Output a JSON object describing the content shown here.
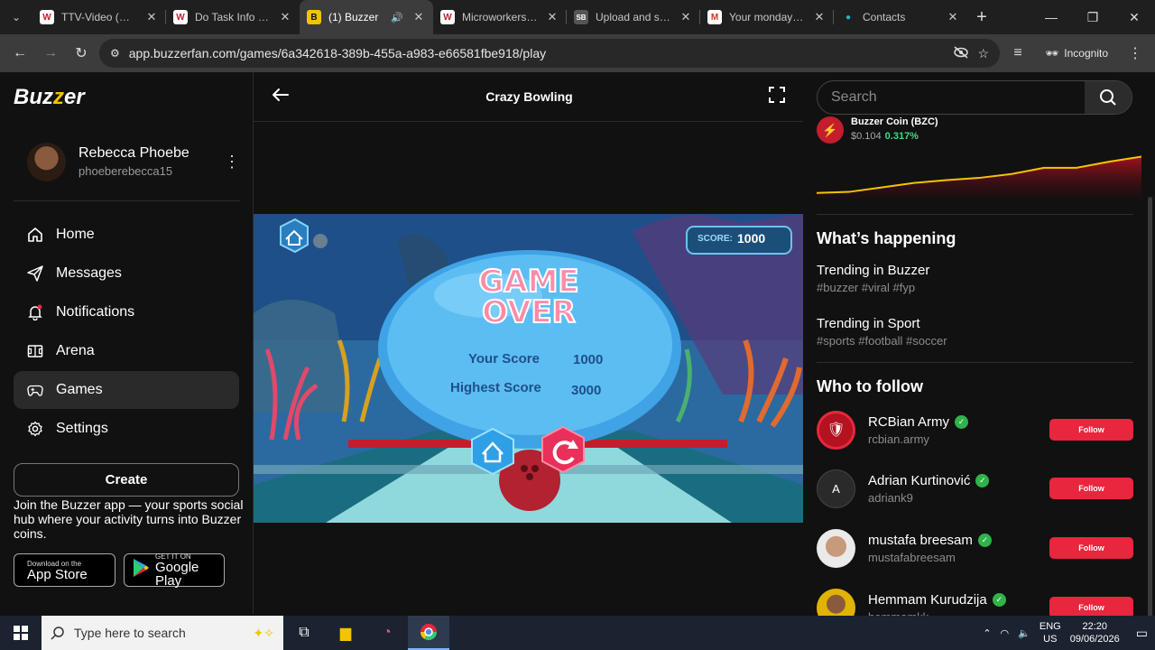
{
  "browser": {
    "tabs": [
      {
        "title": "TTV-Video (CC):",
        "favicon": "W",
        "fav_color": "#c41d2d"
      },
      {
        "title": "Do Task Info | M",
        "favicon": "W",
        "fav_color": "#c41d2d"
      },
      {
        "title": "(1) Buzzer",
        "favicon": "B",
        "fav_color": "#f5c400"
      },
      {
        "title": "Microworkers - v",
        "favicon": "W",
        "fav_color": "#c41d2d"
      },
      {
        "title": "Upload and sha",
        "favicon": "SB",
        "fav_color": "#555555"
      },
      {
        "title": "Your monday CR",
        "favicon": "M",
        "fav_color": "#d93025"
      },
      {
        "title": "Contacts",
        "favicon": "●",
        "fav_color": "#1fb6c9"
      }
    ],
    "url": "app.buzzerfan.com/games/6a342618-389b-455a-a983-e66581fbe918/play",
    "incognito_label": "Incognito"
  },
  "sidebar": {
    "logo": "Buzzer",
    "user": {
      "name": "Rebecca Phoebe",
      "handle": "phoeberebecca15"
    },
    "menu": [
      {
        "label": "Home",
        "icon": "home-icon"
      },
      {
        "label": "Messages",
        "icon": "send-icon"
      },
      {
        "label": "Notifications",
        "icon": "bell-icon"
      },
      {
        "label": "Arena",
        "icon": "arena-icon"
      },
      {
        "label": "Games",
        "icon": "gamepad-icon"
      },
      {
        "label": "Settings",
        "icon": "gear-icon"
      }
    ],
    "create_label": "Create",
    "promo_text": "Join the Buzzer app — your sports social hub where your activity turns into Buzzer coins.",
    "app_store": {
      "small": "Download on the",
      "big": "App Store"
    },
    "google_play": {
      "small": "GET IT ON",
      "big": "Google Play"
    }
  },
  "main": {
    "title": "Crazy Bowling",
    "game": {
      "score_label": "SCORE:",
      "score_value": "1000",
      "headline_1": "GAME",
      "headline_2": "OVER",
      "your_score_label": "Your Score",
      "your_score_value": "1000",
      "highest_score_label": "Highest Score",
      "highest_score_value": "3000"
    }
  },
  "right": {
    "search_placeholder": "Search",
    "coin": {
      "name": "Buzzer Coin (BZC)",
      "price": "$0.104",
      "change": "0.317%"
    },
    "whats_happening": "What’s happening",
    "trends": [
      {
        "title": "Trending in Buzzer",
        "tags": "#buzzer #viral #fyp"
      },
      {
        "title": "Trending in Sport",
        "tags": "#sports #football #soccer"
      }
    ],
    "who_to_follow": "Who to follow",
    "follow_label": "Follow",
    "suggestions": [
      {
        "name": "RCBian Army",
        "handle": "rcbian.army",
        "avatar_text": "",
        "avatar_color": "#b3121f"
      },
      {
        "name": "Adrian Kurtinović",
        "handle": "adriank9",
        "avatar_text": "A",
        "avatar_color": "#2a2a2a"
      },
      {
        "name": "mustafa breesam",
        "handle": "mustafabreesam",
        "avatar_text": "",
        "avatar_color": "#cfcfcf"
      },
      {
        "name": "Hemmam Kurudzija",
        "handle": "hemmamkk",
        "avatar_text": "",
        "avatar_color": "#e0b400"
      }
    ]
  },
  "taskbar": {
    "search_placeholder": "Type here to search",
    "lang_1": "ENG",
    "lang_2": "US",
    "time": "22:20",
    "date": "09/06/2026"
  },
  "chart_data": {
    "type": "area",
    "values": [
      0.1,
      0.12,
      0.2,
      0.28,
      0.33,
      0.37,
      0.44,
      0.55,
      0.55,
      0.66,
      0.75
    ],
    "color": "#f5c400"
  }
}
